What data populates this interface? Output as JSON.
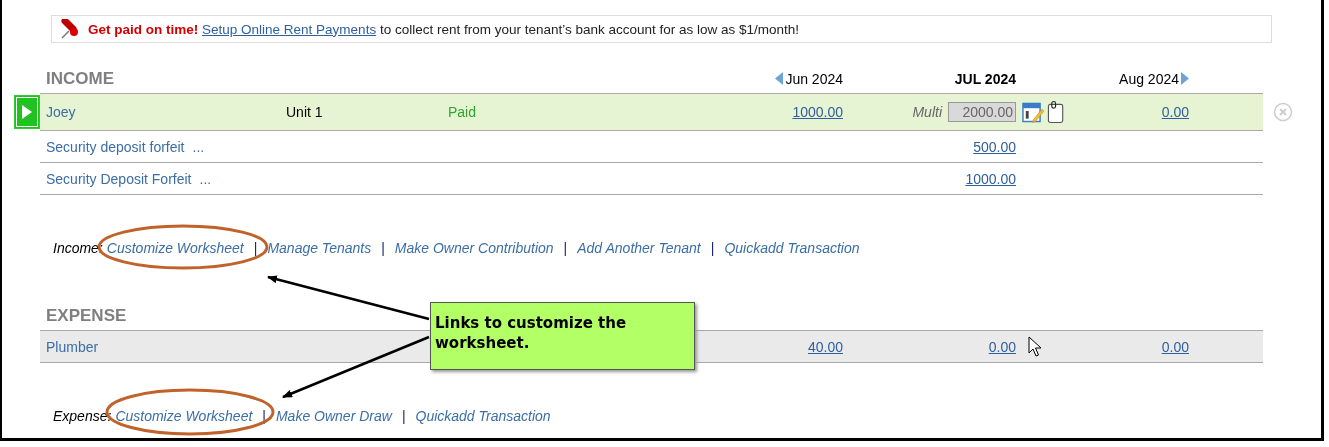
{
  "banner": {
    "emphasis": "Get paid on time!",
    "link": "Setup Online Rent Payments",
    "text": " to collect rent from your tenant’s bank account for as low as $1/month!"
  },
  "income": {
    "heading": "INCOME",
    "months": [
      {
        "label": "Jun 2024",
        "selected": false,
        "kind": "prev"
      },
      {
        "label": "JUL 2024",
        "selected": true,
        "kind": "current"
      },
      {
        "label": "Aug 2024",
        "selected": false,
        "kind": "next"
      }
    ],
    "rows": [
      {
        "kind": "tenant",
        "expanded": false,
        "name": "Joey",
        "unit": "Unit 1",
        "status": "Paid",
        "prev": "1000.00",
        "multi_label": "Multi",
        "current": "2000.00",
        "next": "0.00"
      },
      {
        "kind": "charge",
        "name": "Security deposit forfeit",
        "more": "...",
        "current": "500.00"
      },
      {
        "kind": "charge",
        "name": "Security Deposit Forfeit",
        "more": "...",
        "current": "1000.00"
      }
    ],
    "links_label": "Income:",
    "links": [
      "Customize Worksheet",
      "Manage Tenants",
      "Make Owner Contribution",
      "Add Another Tenant",
      "Quickadd Transaction"
    ],
    "separators": [
      "|",
      "|",
      "|",
      "|"
    ]
  },
  "expense": {
    "heading": "EXPENSE",
    "rows": [
      {
        "kind": "expense",
        "name": "Plumber",
        "prev": "40.00",
        "current": "0.00",
        "next": "0.00"
      }
    ],
    "links_label": "Expense:",
    "links": [
      "Customize Worksheet",
      "Make Owner Draw",
      "Quickadd Transaction"
    ],
    "separators": [
      "|",
      "|"
    ]
  },
  "callout": {
    "text": "Links to customize the worksheet."
  }
}
